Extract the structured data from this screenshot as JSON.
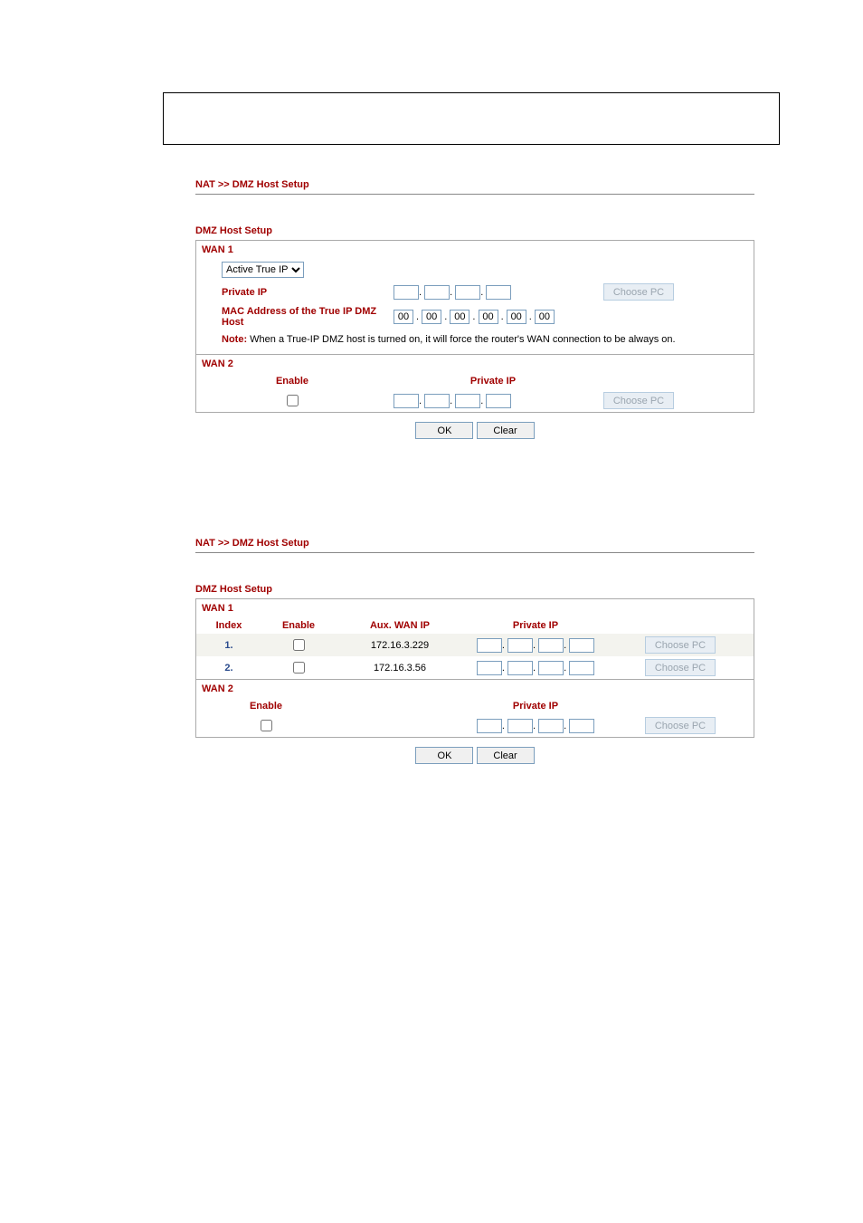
{
  "breadcrumb": "NAT >> DMZ Host Setup",
  "sectionTitle": "DMZ Host Setup",
  "panel1": {
    "wan1": {
      "head": "WAN 1",
      "dropdown": "Active True IP",
      "privateIpLabel": "Private IP",
      "choose": "Choose PC",
      "macLabel": "MAC Address of the True IP DMZ Host",
      "mac": [
        "00",
        "00",
        "00",
        "00",
        "00",
        "00"
      ],
      "noteLead": "Note:",
      "noteText": " When a True-IP DMZ host is turned on, it will force the router's WAN connection to be always on."
    },
    "wan2": {
      "head": "WAN 2",
      "enable": "Enable",
      "privateIP": "Private IP",
      "choose": "Choose PC"
    },
    "ok": "OK",
    "clear": "Clear"
  },
  "panel2": {
    "wan1": {
      "head": "WAN 1",
      "hdr": {
        "index": "Index",
        "enable": "Enable",
        "aux": "Aux. WAN IP",
        "pip": "Private IP"
      },
      "rows": [
        {
          "idx": "1.",
          "aux": "172.16.3.229",
          "choose": "Choose PC"
        },
        {
          "idx": "2.",
          "aux": "172.16.3.56",
          "choose": "Choose PC"
        }
      ]
    },
    "wan2": {
      "head": "WAN 2",
      "enable": "Enable",
      "privateIP": "Private IP",
      "choose": "Choose PC"
    },
    "ok": "OK",
    "clear": "Clear"
  }
}
